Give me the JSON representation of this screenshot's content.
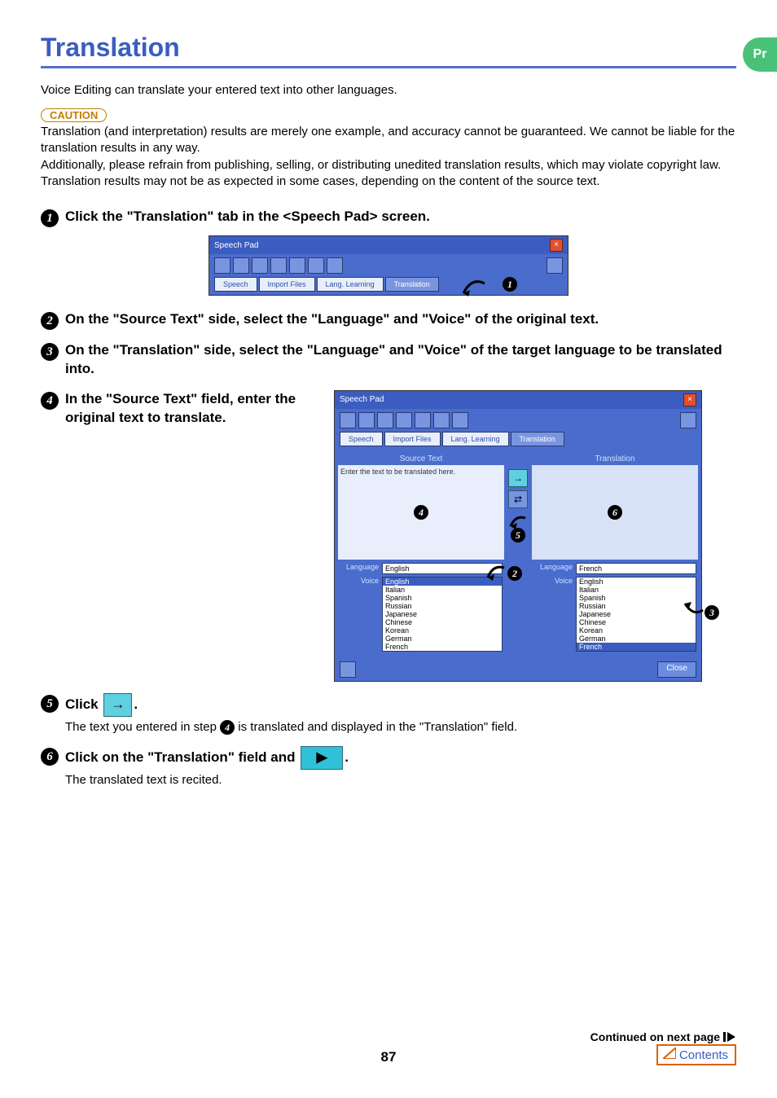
{
  "title": "Translation",
  "pr_badge": "Pr",
  "intro": "Voice Editing can translate your entered text into other languages.",
  "caution": {
    "label": "CAUTION",
    "lines": [
      "Translation (and interpretation) results are merely one example, and accuracy cannot be guaranteed. We cannot be liable for the translation results in any way.",
      "Additionally, please refrain from publishing, selling, or distributing unedited translation results, which may violate copyright law.",
      "Translation results may not be as expected in some cases, depending on the content of the source text."
    ]
  },
  "steps": {
    "s1": "Click the \"Translation\" tab in the <Speech Pad> screen.",
    "s2": "On the \"Source Text\" side, select the \"Language\" and \"Voice\" of the original text.",
    "s3": "On the \"Translation\" side, select the \"Language\" and \"Voice\" of the target language to be translated into.",
    "s4": "In the \"Source Text\" field, enter the original text to translate.",
    "s5_prefix": "Click ",
    "s5_suffix": ".",
    "s5_body_before": "The text you entered in step ",
    "s5_body_after": " is translated and displayed in the \"Translation\" field.",
    "s6_prefix": "Click on the \"Translation\" field and ",
    "s6_suffix": ".",
    "s6_body": "The translated text is recited."
  },
  "speechpad": {
    "title": "Speech Pad",
    "tabs": [
      "Speech",
      "Import Files",
      "Lang. Learning",
      "Translation"
    ],
    "panels": {
      "source_label": "Source Text",
      "translation_label": "Translation",
      "placeholder": "Enter the text to be translated here."
    },
    "labels": {
      "language": "Language",
      "voice": "Voice"
    },
    "source_lang": "English",
    "target_lang": "French",
    "voice_options": [
      "English",
      "Italian",
      "Spanish",
      "Russian",
      "Japanese",
      "Chinese",
      "Korean",
      "German",
      "French"
    ],
    "close": "Close"
  },
  "footer": {
    "continued": "Continued on next page",
    "page": "87",
    "contents": "Contents"
  }
}
